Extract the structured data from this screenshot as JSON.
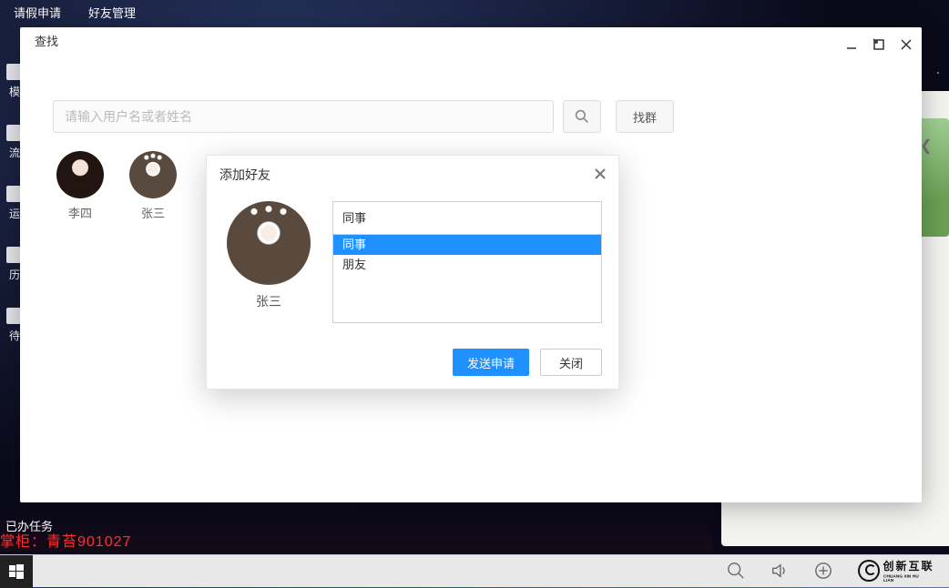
{
  "top_menu": {
    "item1": "请假申请",
    "item2": "好友管理"
  },
  "sidebar": {
    "items": [
      {
        "label": "模"
      },
      {
        "label": "流"
      },
      {
        "label": "运"
      },
      {
        "label": "历"
      },
      {
        "label": "待"
      }
    ]
  },
  "task_label": "已办任务",
  "watermark_red": "掌柜：青苔901027",
  "dialog_main": {
    "title": "查找",
    "search_placeholder": "请输入用户名或者姓名",
    "group_btn": "找群",
    "results": [
      {
        "name": "李四"
      },
      {
        "name": "张三"
      }
    ]
  },
  "modal_add_friend": {
    "title": "添加好友",
    "user_name": "张三",
    "combo_selected": "同事",
    "combo_items": [
      {
        "label": "同事",
        "selected": true
      },
      {
        "label": "朋友",
        "selected": false
      }
    ],
    "btn_send": "发送申请",
    "btn_close": "关闭"
  },
  "logo_text": "创新互联",
  "logo_sub": "CHUANG XIN HU LIAN"
}
